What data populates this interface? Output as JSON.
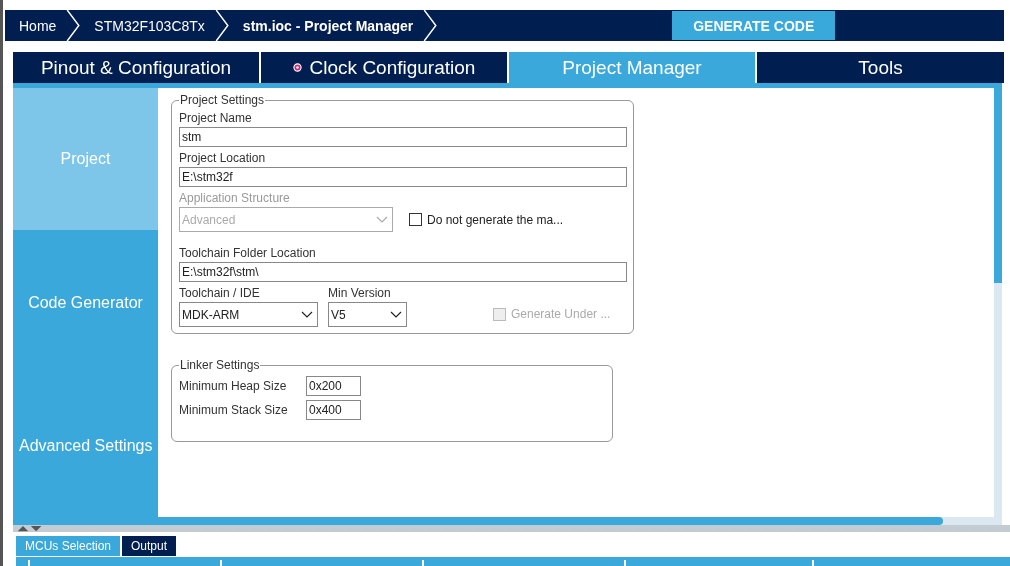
{
  "breadcrumbs": [
    {
      "label": "Home",
      "current": false
    },
    {
      "label": "STM32F103C8Tx",
      "current": false
    },
    {
      "label": "stm.ioc - Project Manager",
      "current": true
    }
  ],
  "generate_button": "GENERATE CODE",
  "tabs": [
    {
      "label": "Pinout & Configuration",
      "selected": false,
      "warning": false
    },
    {
      "label": "Clock Configuration",
      "selected": false,
      "warning": true
    },
    {
      "label": "Project Manager",
      "selected": true,
      "warning": false
    },
    {
      "label": "Tools",
      "selected": false,
      "warning": false
    }
  ],
  "sidebar": {
    "items": [
      {
        "label": "Project",
        "selected": true
      },
      {
        "label": "Code Generator",
        "selected": false
      },
      {
        "label": "Advanced Settings",
        "selected": false
      }
    ]
  },
  "project_settings": {
    "title": "Project Settings",
    "project_name": {
      "label": "Project Name",
      "value": "stm"
    },
    "project_location": {
      "label": "Project Location",
      "value": "E:\\stm32f"
    },
    "application_structure": {
      "label": "Application Structure",
      "value": "Advanced",
      "disabled": true
    },
    "do_not_generate": {
      "label": "Do not generate the ma...",
      "checked": false,
      "disabled": false
    },
    "toolchain_folder": {
      "label": "Toolchain Folder Location",
      "value": "E:\\stm32f\\stm\\"
    },
    "toolchain_ide": {
      "label": "Toolchain / IDE",
      "value": "MDK-ARM"
    },
    "min_version": {
      "label": "Min Version",
      "value": "V5"
    },
    "generate_under_root": {
      "label": "Generate Under ...",
      "checked": false,
      "disabled": true
    }
  },
  "linker_settings": {
    "title": "Linker Settings",
    "fields": [
      {
        "label": "Minimum Heap Size",
        "value": "0x200"
      },
      {
        "label": "Minimum Stack Size",
        "value": "0x400"
      }
    ]
  },
  "bottom_tabs": [
    {
      "label": "MCUs Selection",
      "selected": true
    },
    {
      "label": "Output",
      "selected": false
    }
  ]
}
